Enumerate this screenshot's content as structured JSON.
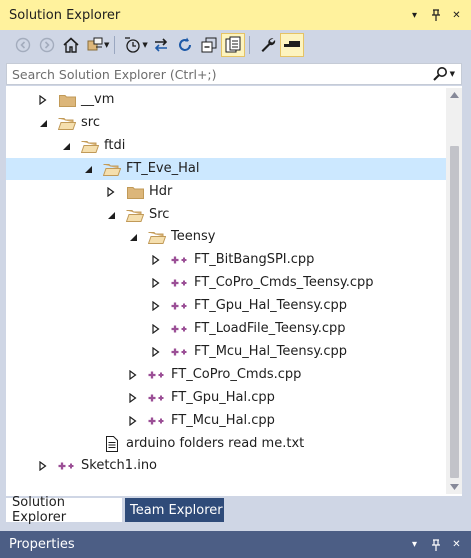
{
  "window": {
    "title": "Solution Explorer",
    "buttons": {
      "dropdown": "▾",
      "pin": "ᛘ",
      "close": "✕"
    }
  },
  "toolbar": {
    "items": [
      "back-icon",
      "forward-icon",
      "home-icon",
      "switch-views-icon",
      "pending-changes-filter-icon",
      "sync-with-active-document-icon",
      "refresh-icon",
      "collapse-all-icon",
      "show-all-files-icon",
      "properties-icon",
      "preview-selected-items-icon"
    ]
  },
  "search": {
    "placeholder": "Search Solution Explorer (Ctrl+;)"
  },
  "tree": {
    "rows": [
      {
        "label": "__vm",
        "type": "folder",
        "state": "collapsed",
        "level": 1
      },
      {
        "label": "src",
        "type": "folder",
        "state": "expanded",
        "level": 1
      },
      {
        "label": "ftdi",
        "type": "folder",
        "state": "expanded",
        "level": 2
      },
      {
        "label": "FT_Eve_Hal",
        "type": "folder",
        "state": "expanded",
        "level": 3,
        "selected": true
      },
      {
        "label": "Hdr",
        "type": "folder",
        "state": "collapsed",
        "level": 4
      },
      {
        "label": "Src",
        "type": "folder",
        "state": "expanded",
        "level": 4
      },
      {
        "label": "Teensy",
        "type": "folder",
        "state": "expanded",
        "level": 5
      },
      {
        "label": "FT_BitBangSPI.cpp",
        "type": "cpp",
        "state": "collapsed",
        "level": 6
      },
      {
        "label": "FT_CoPro_Cmds_Teensy.cpp",
        "type": "cpp",
        "state": "collapsed",
        "level": 6
      },
      {
        "label": "FT_Gpu_Hal_Teensy.cpp",
        "type": "cpp",
        "state": "collapsed",
        "level": 6
      },
      {
        "label": "FT_LoadFile_Teensy.cpp",
        "type": "cpp",
        "state": "collapsed",
        "level": 6
      },
      {
        "label": "FT_Mcu_Hal_Teensy.cpp",
        "type": "cpp",
        "state": "collapsed",
        "level": 6
      },
      {
        "label": "FT_CoPro_Cmds.cpp",
        "type": "cpp",
        "state": "collapsed",
        "level": 5
      },
      {
        "label": "FT_Gpu_Hal.cpp",
        "type": "cpp",
        "state": "collapsed",
        "level": 5
      },
      {
        "label": "FT_Mcu_Hal.cpp",
        "type": "cpp",
        "state": "collapsed",
        "level": 5
      },
      {
        "label": "arduino folders read me.txt",
        "type": "txt",
        "state": "none",
        "level": 3
      },
      {
        "label": "Sketch1.ino",
        "type": "cpp",
        "state": "collapsed",
        "level": 1
      }
    ]
  },
  "tabs": [
    {
      "label": "Solution Explorer",
      "active": true
    },
    {
      "label": "Team Explorer",
      "active": false
    }
  ],
  "properties": {
    "title": "Properties"
  },
  "colors": {
    "title_bar": "#fff29d",
    "chrome": "#cfd6e5",
    "selection": "#cce8ff",
    "folder": "#dcb67a",
    "cpp_icon": "#9b4f96",
    "inactive_tab": "#2f4b79",
    "properties_header": "#4c5e85"
  }
}
